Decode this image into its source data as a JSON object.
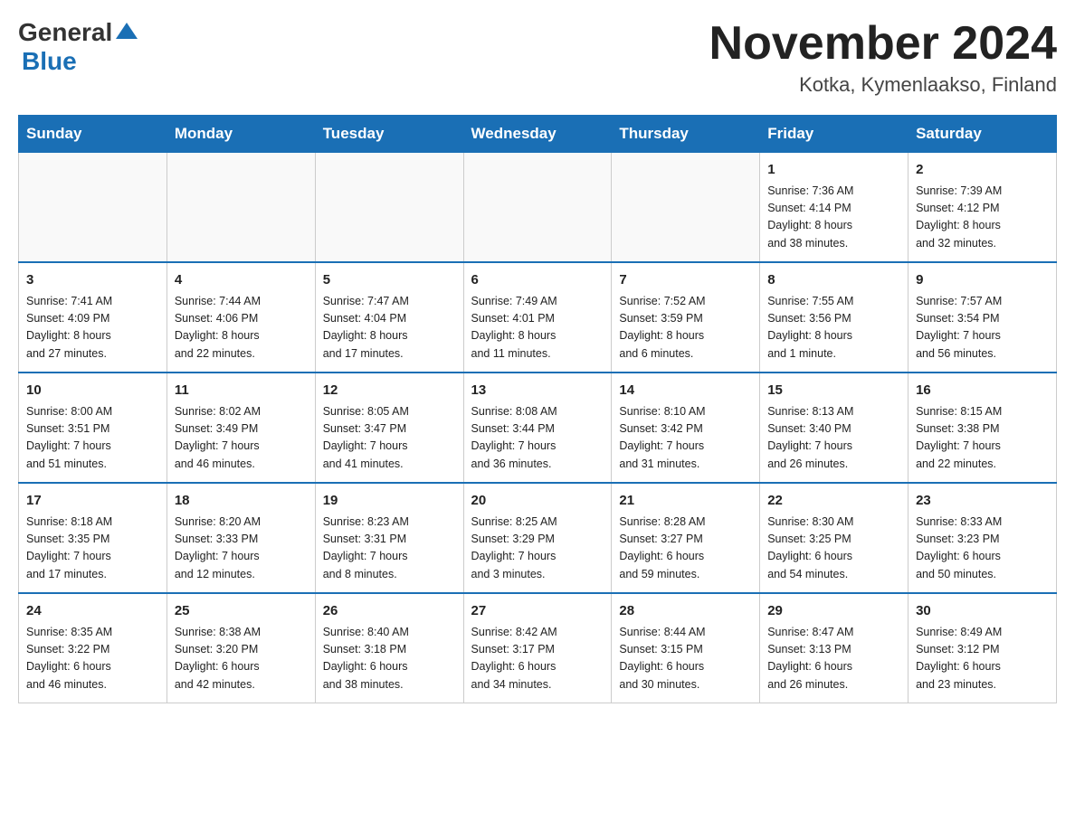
{
  "header": {
    "logo_general": "General",
    "logo_blue": "Blue",
    "month_title": "November 2024",
    "location": "Kotka, Kymenlaakso, Finland"
  },
  "weekdays": [
    "Sunday",
    "Monday",
    "Tuesday",
    "Wednesday",
    "Thursday",
    "Friday",
    "Saturday"
  ],
  "weeks": [
    [
      {
        "day": "",
        "info": ""
      },
      {
        "day": "",
        "info": ""
      },
      {
        "day": "",
        "info": ""
      },
      {
        "day": "",
        "info": ""
      },
      {
        "day": "",
        "info": ""
      },
      {
        "day": "1",
        "info": "Sunrise: 7:36 AM\nSunset: 4:14 PM\nDaylight: 8 hours\nand 38 minutes."
      },
      {
        "day": "2",
        "info": "Sunrise: 7:39 AM\nSunset: 4:12 PM\nDaylight: 8 hours\nand 32 minutes."
      }
    ],
    [
      {
        "day": "3",
        "info": "Sunrise: 7:41 AM\nSunset: 4:09 PM\nDaylight: 8 hours\nand 27 minutes."
      },
      {
        "day": "4",
        "info": "Sunrise: 7:44 AM\nSunset: 4:06 PM\nDaylight: 8 hours\nand 22 minutes."
      },
      {
        "day": "5",
        "info": "Sunrise: 7:47 AM\nSunset: 4:04 PM\nDaylight: 8 hours\nand 17 minutes."
      },
      {
        "day": "6",
        "info": "Sunrise: 7:49 AM\nSunset: 4:01 PM\nDaylight: 8 hours\nand 11 minutes."
      },
      {
        "day": "7",
        "info": "Sunrise: 7:52 AM\nSunset: 3:59 PM\nDaylight: 8 hours\nand 6 minutes."
      },
      {
        "day": "8",
        "info": "Sunrise: 7:55 AM\nSunset: 3:56 PM\nDaylight: 8 hours\nand 1 minute."
      },
      {
        "day": "9",
        "info": "Sunrise: 7:57 AM\nSunset: 3:54 PM\nDaylight: 7 hours\nand 56 minutes."
      }
    ],
    [
      {
        "day": "10",
        "info": "Sunrise: 8:00 AM\nSunset: 3:51 PM\nDaylight: 7 hours\nand 51 minutes."
      },
      {
        "day": "11",
        "info": "Sunrise: 8:02 AM\nSunset: 3:49 PM\nDaylight: 7 hours\nand 46 minutes."
      },
      {
        "day": "12",
        "info": "Sunrise: 8:05 AM\nSunset: 3:47 PM\nDaylight: 7 hours\nand 41 minutes."
      },
      {
        "day": "13",
        "info": "Sunrise: 8:08 AM\nSunset: 3:44 PM\nDaylight: 7 hours\nand 36 minutes."
      },
      {
        "day": "14",
        "info": "Sunrise: 8:10 AM\nSunset: 3:42 PM\nDaylight: 7 hours\nand 31 minutes."
      },
      {
        "day": "15",
        "info": "Sunrise: 8:13 AM\nSunset: 3:40 PM\nDaylight: 7 hours\nand 26 minutes."
      },
      {
        "day": "16",
        "info": "Sunrise: 8:15 AM\nSunset: 3:38 PM\nDaylight: 7 hours\nand 22 minutes."
      }
    ],
    [
      {
        "day": "17",
        "info": "Sunrise: 8:18 AM\nSunset: 3:35 PM\nDaylight: 7 hours\nand 17 minutes."
      },
      {
        "day": "18",
        "info": "Sunrise: 8:20 AM\nSunset: 3:33 PM\nDaylight: 7 hours\nand 12 minutes."
      },
      {
        "day": "19",
        "info": "Sunrise: 8:23 AM\nSunset: 3:31 PM\nDaylight: 7 hours\nand 8 minutes."
      },
      {
        "day": "20",
        "info": "Sunrise: 8:25 AM\nSunset: 3:29 PM\nDaylight: 7 hours\nand 3 minutes."
      },
      {
        "day": "21",
        "info": "Sunrise: 8:28 AM\nSunset: 3:27 PM\nDaylight: 6 hours\nand 59 minutes."
      },
      {
        "day": "22",
        "info": "Sunrise: 8:30 AM\nSunset: 3:25 PM\nDaylight: 6 hours\nand 54 minutes."
      },
      {
        "day": "23",
        "info": "Sunrise: 8:33 AM\nSunset: 3:23 PM\nDaylight: 6 hours\nand 50 minutes."
      }
    ],
    [
      {
        "day": "24",
        "info": "Sunrise: 8:35 AM\nSunset: 3:22 PM\nDaylight: 6 hours\nand 46 minutes."
      },
      {
        "day": "25",
        "info": "Sunrise: 8:38 AM\nSunset: 3:20 PM\nDaylight: 6 hours\nand 42 minutes."
      },
      {
        "day": "26",
        "info": "Sunrise: 8:40 AM\nSunset: 3:18 PM\nDaylight: 6 hours\nand 38 minutes."
      },
      {
        "day": "27",
        "info": "Sunrise: 8:42 AM\nSunset: 3:17 PM\nDaylight: 6 hours\nand 34 minutes."
      },
      {
        "day": "28",
        "info": "Sunrise: 8:44 AM\nSunset: 3:15 PM\nDaylight: 6 hours\nand 30 minutes."
      },
      {
        "day": "29",
        "info": "Sunrise: 8:47 AM\nSunset: 3:13 PM\nDaylight: 6 hours\nand 26 minutes."
      },
      {
        "day": "30",
        "info": "Sunrise: 8:49 AM\nSunset: 3:12 PM\nDaylight: 6 hours\nand 23 minutes."
      }
    ]
  ]
}
